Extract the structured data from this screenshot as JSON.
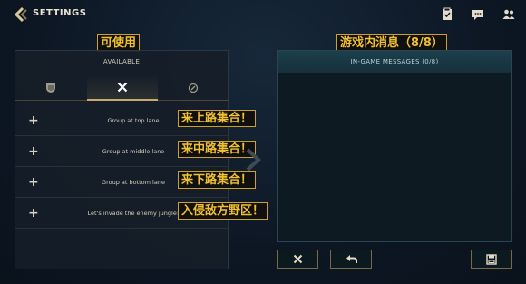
{
  "header": {
    "title": "SETTINGS"
  },
  "left_panel": {
    "annotation_cn": "可使用",
    "heading": "AVAILABLE",
    "tabs": [
      {
        "icon": "shield-icon"
      },
      {
        "icon": "crossed-swords-icon"
      },
      {
        "icon": "ward-icon"
      }
    ],
    "items": [
      {
        "label": "Group at top lane",
        "annotation_cn": "来上路集合！"
      },
      {
        "label": "Group at middle lane",
        "annotation_cn": "来中路集合！"
      },
      {
        "label": "Group at bottom lane",
        "annotation_cn": "来下路集合！"
      },
      {
        "label": "Let's invade the enemy jungle!",
        "annotation_cn": "入侵敌方野区！"
      }
    ]
  },
  "right_panel": {
    "annotation_cn": "游戏内消息（8/8）",
    "heading": "IN-GAME MESSAGES (0/8)"
  },
  "buttons": {
    "delete": "close-icon",
    "reset": "undo-icon",
    "save": "save-icon"
  },
  "top_icons": [
    "clipboard-icon",
    "chat-icon",
    "friends-icon"
  ],
  "colors": {
    "accent": "#c8aa6e",
    "annotation": "#f0c030",
    "background": "#0d1724"
  }
}
